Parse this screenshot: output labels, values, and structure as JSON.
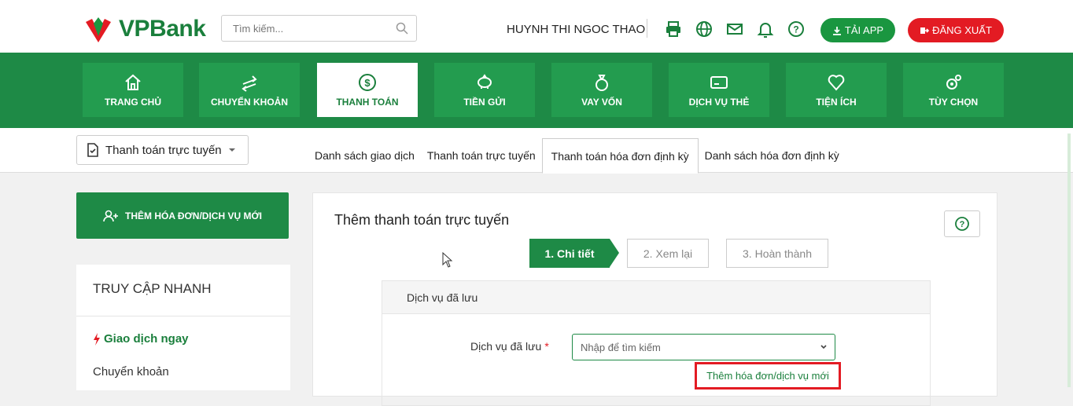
{
  "brand": {
    "name_vp": "VP",
    "name_bank": "Bank",
    "color": "#1a7f3c",
    "accent": "#e31b23"
  },
  "header": {
    "search_placeholder": "Tìm kiếm...",
    "username": "HUYNH THI NGOC THAO",
    "icons": [
      "printer-icon",
      "globe-icon",
      "mail-icon",
      "bell-icon",
      "help-icon"
    ],
    "app_button": "TẢI APP",
    "logout_button": "ĐĂNG XUẤT"
  },
  "nav": {
    "items": [
      {
        "label": "TRANG CHỦ",
        "icon": "home-icon"
      },
      {
        "label": "CHUYỂN KHOẢN",
        "icon": "transfer-icon"
      },
      {
        "label": "THANH TOÁN",
        "icon": "dollar-icon",
        "active": true
      },
      {
        "label": "TIỀN GỬI",
        "icon": "piggy-bank-icon"
      },
      {
        "label": "VAY VỐN",
        "icon": "money-bag-icon"
      },
      {
        "label": "DỊCH VỤ THẺ",
        "icon": "card-icon"
      },
      {
        "label": "TIỆN ÍCH",
        "icon": "heart-icon"
      },
      {
        "label": "TÙY CHỌN",
        "icon": "gear-icon"
      }
    ]
  },
  "subbar": {
    "dropdown_label": "Thanh toán trực tuyến",
    "tabs": [
      {
        "label": "Danh sách giao dịch"
      },
      {
        "label": "Thanh toán trực tuyến"
      },
      {
        "label": "Thanh toán hóa đơn định kỳ",
        "active": true
      },
      {
        "label": "Danh sách hóa đơn định kỳ"
      }
    ]
  },
  "sidebar": {
    "add_button": "THÊM HÓA ĐƠN/DỊCH VỤ MỚI",
    "quick_title": "TRUY CẬP NHANH",
    "quick_items": [
      "Giao dịch ngay",
      "Chuyển khoản"
    ]
  },
  "main": {
    "title": "Thêm thanh toán trực tuyến",
    "steps": [
      "1. Chi tiết",
      "2. Xem lại",
      "3. Hoàn thành"
    ],
    "panel_title": "Dịch vụ đã lưu",
    "field_label": "Dịch vụ đã lưu",
    "required_mark": "*",
    "select_placeholder": "Nhập để tìm kiếm",
    "add_link": "Thêm hóa đơn/dịch vụ mới"
  }
}
